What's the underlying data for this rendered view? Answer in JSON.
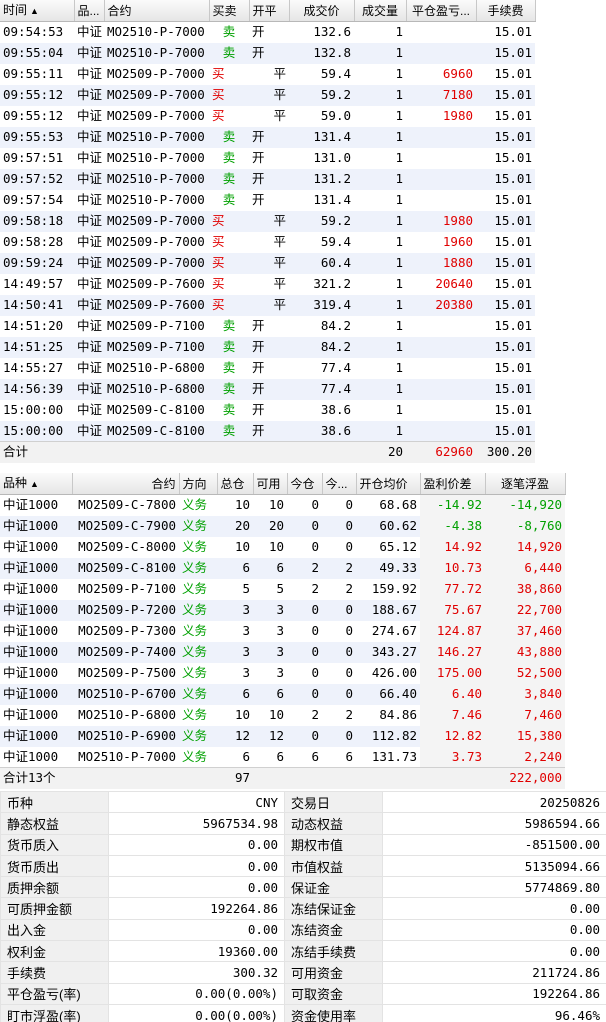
{
  "trades": {
    "headers": [
      "时间",
      "品...",
      "合约",
      "买卖",
      "开平",
      "成交价",
      "成交量",
      "平仓盈亏...",
      "手续费"
    ],
    "sort_indicator": "▲",
    "rows": [
      {
        "time": "09:54:53",
        "variety": "中证",
        "contract": "MO2510-P-7000",
        "side": "卖",
        "oc": "开",
        "price": "132.6",
        "qty": "1",
        "pnl": "",
        "fee": "15.01"
      },
      {
        "time": "09:55:04",
        "variety": "中证",
        "contract": "MO2510-P-7000",
        "side": "卖",
        "oc": "开",
        "price": "132.8",
        "qty": "1",
        "pnl": "",
        "fee": "15.01"
      },
      {
        "time": "09:55:11",
        "variety": "中证",
        "contract": "MO2509-P-7000",
        "side": "买",
        "oc": "平",
        "price": "59.4",
        "qty": "1",
        "pnl": "6960",
        "fee": "15.01"
      },
      {
        "time": "09:55:12",
        "variety": "中证",
        "contract": "MO2509-P-7000",
        "side": "买",
        "oc": "平",
        "price": "59.2",
        "qty": "1",
        "pnl": "7180",
        "fee": "15.01"
      },
      {
        "time": "09:55:12",
        "variety": "中证",
        "contract": "MO2509-P-7000",
        "side": "买",
        "oc": "平",
        "price": "59.0",
        "qty": "1",
        "pnl": "1980",
        "fee": "15.01"
      },
      {
        "time": "09:55:53",
        "variety": "中证",
        "contract": "MO2510-P-7000",
        "side": "卖",
        "oc": "开",
        "price": "131.4",
        "qty": "1",
        "pnl": "",
        "fee": "15.01"
      },
      {
        "time": "09:57:51",
        "variety": "中证",
        "contract": "MO2510-P-7000",
        "side": "卖",
        "oc": "开",
        "price": "131.0",
        "qty": "1",
        "pnl": "",
        "fee": "15.01"
      },
      {
        "time": "09:57:52",
        "variety": "中证",
        "contract": "MO2510-P-7000",
        "side": "卖",
        "oc": "开",
        "price": "131.2",
        "qty": "1",
        "pnl": "",
        "fee": "15.01"
      },
      {
        "time": "09:57:54",
        "variety": "中证",
        "contract": "MO2510-P-7000",
        "side": "卖",
        "oc": "开",
        "price": "131.4",
        "qty": "1",
        "pnl": "",
        "fee": "15.01"
      },
      {
        "time": "09:58:18",
        "variety": "中证",
        "contract": "MO2509-P-7000",
        "side": "买",
        "oc": "平",
        "price": "59.2",
        "qty": "1",
        "pnl": "1980",
        "fee": "15.01"
      },
      {
        "time": "09:58:28",
        "variety": "中证",
        "contract": "MO2509-P-7000",
        "side": "买",
        "oc": "平",
        "price": "59.4",
        "qty": "1",
        "pnl": "1960",
        "fee": "15.01"
      },
      {
        "time": "09:59:24",
        "variety": "中证",
        "contract": "MO2509-P-7000",
        "side": "买",
        "oc": "平",
        "price": "60.4",
        "qty": "1",
        "pnl": "1880",
        "fee": "15.01"
      },
      {
        "time": "14:49:57",
        "variety": "中证",
        "contract": "MO2509-P-7600",
        "side": "买",
        "oc": "平",
        "price": "321.2",
        "qty": "1",
        "pnl": "20640",
        "fee": "15.01"
      },
      {
        "time": "14:50:41",
        "variety": "中证",
        "contract": "MO2509-P-7600",
        "side": "买",
        "oc": "平",
        "price": "319.4",
        "qty": "1",
        "pnl": "20380",
        "fee": "15.01"
      },
      {
        "time": "14:51:20",
        "variety": "中证",
        "contract": "MO2509-P-7100",
        "side": "卖",
        "oc": "开",
        "price": "84.2",
        "qty": "1",
        "pnl": "",
        "fee": "15.01"
      },
      {
        "time": "14:51:25",
        "variety": "中证",
        "contract": "MO2509-P-7100",
        "side": "卖",
        "oc": "开",
        "price": "84.2",
        "qty": "1",
        "pnl": "",
        "fee": "15.01"
      },
      {
        "time": "14:55:27",
        "variety": "中证",
        "contract": "MO2510-P-6800",
        "side": "卖",
        "oc": "开",
        "price": "77.4",
        "qty": "1",
        "pnl": "",
        "fee": "15.01"
      },
      {
        "time": "14:56:39",
        "variety": "中证",
        "contract": "MO2510-P-6800",
        "side": "卖",
        "oc": "开",
        "price": "77.4",
        "qty": "1",
        "pnl": "",
        "fee": "15.01"
      },
      {
        "time": "15:00:00",
        "variety": "中证",
        "contract": "MO2509-C-8100",
        "side": "卖",
        "oc": "开",
        "price": "38.6",
        "qty": "1",
        "pnl": "",
        "fee": "15.01"
      },
      {
        "time": "15:00:00",
        "variety": "中证",
        "contract": "MO2509-C-8100",
        "side": "卖",
        "oc": "开",
        "price": "38.6",
        "qty": "1",
        "pnl": "",
        "fee": "15.01"
      }
    ],
    "total": {
      "label": "合计",
      "qty": "20",
      "pnl": "62960",
      "fee": "300.20"
    }
  },
  "positions": {
    "headers": [
      "品种",
      "合约",
      "方向",
      "总仓",
      "可用",
      "今仓",
      "今...",
      "开仓均价",
      "盈利价差",
      "逐笔浮盈"
    ],
    "sort_indicator": "▲",
    "rows": [
      {
        "variety": "中证1000",
        "contract": "MO2509-C-7800",
        "dir": "义务",
        "total": "10",
        "avail": "10",
        "today": "0",
        "today2": "0",
        "avg": "68.68",
        "spread": "-14.92",
        "float": "-14,920"
      },
      {
        "variety": "中证1000",
        "contract": "MO2509-C-7900",
        "dir": "义务",
        "total": "20",
        "avail": "20",
        "today": "0",
        "today2": "0",
        "avg": "60.62",
        "spread": "-4.38",
        "float": "-8,760"
      },
      {
        "variety": "中证1000",
        "contract": "MO2509-C-8000",
        "dir": "义务",
        "total": "10",
        "avail": "10",
        "today": "0",
        "today2": "0",
        "avg": "65.12",
        "spread": "14.92",
        "float": "14,920"
      },
      {
        "variety": "中证1000",
        "contract": "MO2509-C-8100",
        "dir": "义务",
        "total": "6",
        "avail": "6",
        "today": "2",
        "today2": "2",
        "avg": "49.33",
        "spread": "10.73",
        "float": "6,440"
      },
      {
        "variety": "中证1000",
        "contract": "MO2509-P-7100",
        "dir": "义务",
        "total": "5",
        "avail": "5",
        "today": "2",
        "today2": "2",
        "avg": "159.92",
        "spread": "77.72",
        "float": "38,860"
      },
      {
        "variety": "中证1000",
        "contract": "MO2509-P-7200",
        "dir": "义务",
        "total": "3",
        "avail": "3",
        "today": "0",
        "today2": "0",
        "avg": "188.67",
        "spread": "75.67",
        "float": "22,700"
      },
      {
        "variety": "中证1000",
        "contract": "MO2509-P-7300",
        "dir": "义务",
        "total": "3",
        "avail": "3",
        "today": "0",
        "today2": "0",
        "avg": "274.67",
        "spread": "124.87",
        "float": "37,460"
      },
      {
        "variety": "中证1000",
        "contract": "MO2509-P-7400",
        "dir": "义务",
        "total": "3",
        "avail": "3",
        "today": "0",
        "today2": "0",
        "avg": "343.27",
        "spread": "146.27",
        "float": "43,880"
      },
      {
        "variety": "中证1000",
        "contract": "MO2509-P-7500",
        "dir": "义务",
        "total": "3",
        "avail": "3",
        "today": "0",
        "today2": "0",
        "avg": "426.00",
        "spread": "175.00",
        "float": "52,500"
      },
      {
        "variety": "中证1000",
        "contract": "MO2510-P-6700",
        "dir": "义务",
        "total": "6",
        "avail": "6",
        "today": "0",
        "today2": "0",
        "avg": "66.40",
        "spread": "6.40",
        "float": "3,840"
      },
      {
        "variety": "中证1000",
        "contract": "MO2510-P-6800",
        "dir": "义务",
        "total": "10",
        "avail": "10",
        "today": "2",
        "today2": "2",
        "avg": "84.86",
        "spread": "7.46",
        "float": "7,460"
      },
      {
        "variety": "中证1000",
        "contract": "MO2510-P-6900",
        "dir": "义务",
        "total": "12",
        "avail": "12",
        "today": "0",
        "today2": "0",
        "avg": "112.82",
        "spread": "12.82",
        "float": "15,380"
      },
      {
        "variety": "中证1000",
        "contract": "MO2510-P-7000",
        "dir": "义务",
        "total": "6",
        "avail": "6",
        "today": "6",
        "today2": "6",
        "avg": "131.73",
        "spread": "3.73",
        "float": "2,240"
      }
    ],
    "total": {
      "label": "合计13个",
      "total": "97",
      "float": "222,000"
    }
  },
  "account": {
    "rows": [
      {
        "l1": "币种",
        "v1": "CNY",
        "l2": "交易日",
        "v2": "20250826"
      },
      {
        "l1": "静态权益",
        "v1": "5967534.98",
        "l2": "动态权益",
        "v2": "5986594.66"
      },
      {
        "l1": "货币质入",
        "v1": "0.00",
        "l2": "期权市值",
        "v2": "-851500.00"
      },
      {
        "l1": "货币质出",
        "v1": "0.00",
        "l2": "市值权益",
        "v2": "5135094.66"
      },
      {
        "l1": "质押余额",
        "v1": "0.00",
        "l2": "保证金",
        "v2": "5774869.80"
      },
      {
        "l1": "可质押金额",
        "v1": "192264.86",
        "l2": "冻结保证金",
        "v2": "0.00"
      },
      {
        "l1": "出入金",
        "v1": "0.00",
        "l2": "冻结资金",
        "v2": "0.00"
      },
      {
        "l1": "权利金",
        "v1": "19360.00",
        "l2": "冻结手续费",
        "v2": "0.00"
      },
      {
        "l1": "手续费",
        "v1": "300.32",
        "l2": "可用资金",
        "v2": "211724.86"
      },
      {
        "l1": "平仓盈亏(率)",
        "v1": "0.00(0.00%)",
        "l2": "可取资金",
        "v2": "192264.86"
      },
      {
        "l1": "盯市浮盈(率)",
        "v1": "0.00(0.00%)",
        "l2": "资金使用率",
        "v2": "96.46%"
      }
    ]
  },
  "colors": {
    "buy": "#e00000",
    "sell": "#00a000",
    "row_alt": "#eef2fb"
  }
}
